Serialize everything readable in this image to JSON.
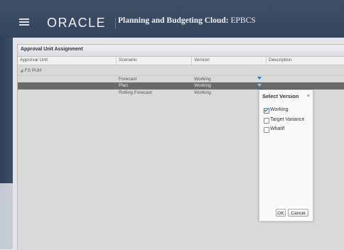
{
  "header": {
    "brand": "ORACLE",
    "app_title": "Planning and Budgeting Cloud:",
    "app_subtitle": "EPBCS"
  },
  "panel": {
    "title": "Approval Unit Assignment",
    "columns": [
      "Approval Unit",
      "Scenario",
      "Version",
      "Description"
    ],
    "tree_node": "FS PUH",
    "rows": [
      {
        "scenario": "Forecast",
        "version": "Working"
      },
      {
        "scenario": "Plan",
        "version": "Working"
      },
      {
        "scenario": "Rolling Forecast",
        "version": "Working"
      }
    ]
  },
  "popup": {
    "title": "Select Version",
    "close": "×",
    "options": [
      {
        "label": "Working",
        "checked": true
      },
      {
        "label": "Target Variance",
        "checked": false
      },
      {
        "label": "WhatIf",
        "checked": false
      }
    ],
    "ok_label": "OK",
    "cancel_label": "Cancel"
  },
  "colors": {
    "header_bg": "#3a4a60",
    "selected_row": "#6a6a6a",
    "dropdown_accent": "#2a7bd6"
  }
}
